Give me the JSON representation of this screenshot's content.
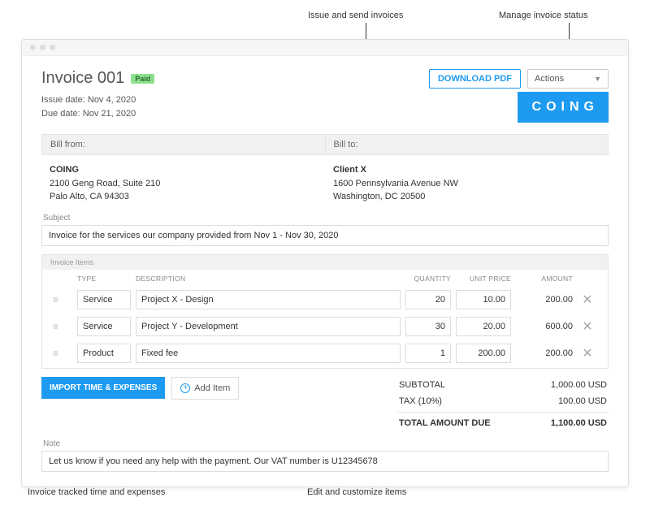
{
  "annotations": {
    "top_send": "Issue and send invoices",
    "top_status": "Manage invoice status",
    "bottom_import": "Invoice tracked time and expenses",
    "bottom_edit": "Edit and customize items"
  },
  "header": {
    "title": "Invoice 001",
    "badge": "Paid",
    "download": "DOWNLOAD PDF",
    "actions": "Actions",
    "issue": "Issue date: Nov 4, 2020",
    "due": "Due date: Nov 21, 2020",
    "logo": "COING"
  },
  "bill": {
    "from_label": "Bill from:",
    "to_label": "Bill to:",
    "from_name": "COING",
    "from_line1": "2100 Geng Road, Suite 210",
    "from_line2": "Palo Alto, CA 94303",
    "to_name": "Client X",
    "to_line1": "1600 Pennsylvania Avenue NW",
    "to_line2": "Washington, DC 20500"
  },
  "subject": {
    "label": "Subject",
    "value": "Invoice for the services our company provided from Nov 1 - Nov 30, 2020"
  },
  "items": {
    "header": "Invoice Items",
    "col_type": "TYPE",
    "col_desc": "DESCRIPTION",
    "col_qty": "QUANTITY",
    "col_price": "UNIT PRICE",
    "col_amount": "AMOUNT",
    "rows": [
      {
        "type": "Service",
        "desc": "Project X - Design",
        "qty": "20",
        "price": "10.00",
        "amount": "200.00"
      },
      {
        "type": "Service",
        "desc": "Project Y - Development",
        "qty": "30",
        "price": "20.00",
        "amount": "600.00"
      },
      {
        "type": "Product",
        "desc": "Fixed fee",
        "qty": "1",
        "price": "200.00",
        "amount": "200.00"
      }
    ]
  },
  "actionsRow": {
    "import": "IMPORT TIME & EXPENSES",
    "addItem": "Add Item"
  },
  "totals": {
    "subtotal_label": "SUBTOTAL",
    "subtotal_val": "1,000.00 USD",
    "tax_label": "TAX  (10%)",
    "tax_val": "100.00 USD",
    "total_label": "TOTAL AMOUNT DUE",
    "total_val": "1,100.00 USD"
  },
  "note": {
    "label": "Note",
    "value": "Let us know if you need any help with the payment. Our VAT number is U12345678"
  }
}
